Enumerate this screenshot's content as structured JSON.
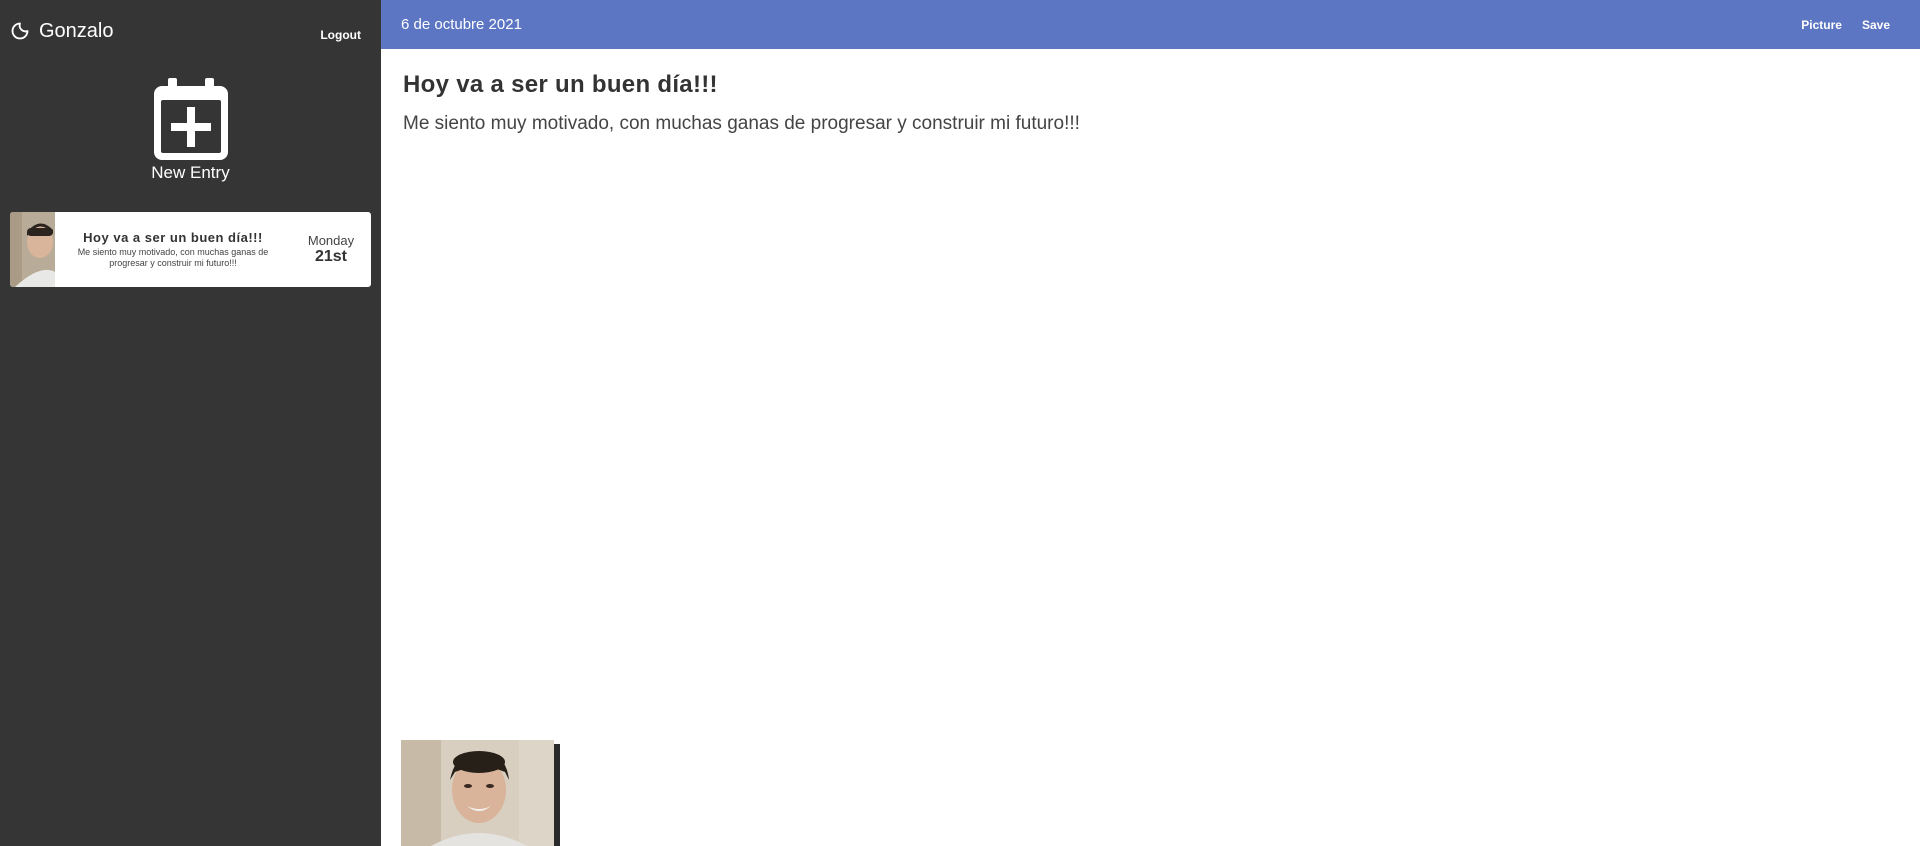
{
  "sidebar": {
    "user_name": "Gonzalo",
    "logout_label": "Logout",
    "new_entry_label": "New Entry",
    "entries": [
      {
        "title": "Hoy va a ser un buen día!!!",
        "text": "Me siento muy motivado, con muchas ganas de progresar y construir mi futuro!!!",
        "day": "Monday",
        "num": "21st"
      }
    ]
  },
  "topbar": {
    "date": "6 de octubre 2021",
    "picture_label": "Picture",
    "save_label": "Save"
  },
  "entry": {
    "title": "Hoy va a ser un buen día!!!",
    "body": "Me siento muy motivado, con muchas ganas de progresar y construir mi futuro!!!"
  },
  "colors": {
    "sidebar_bg": "#353535",
    "topbar_bg": "#5c76c4",
    "main_bg": "#ffffff"
  }
}
